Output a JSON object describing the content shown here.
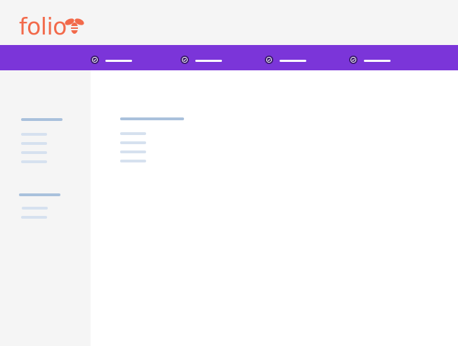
{
  "app": {
    "logo_text": "folio",
    "logo_icon": "bee-icon",
    "brand_color": "#f26a4b",
    "accent_color": "#7b35d9"
  },
  "topbar": {
    "items": [
      {
        "icon": "check-circle-icon",
        "label": ""
      },
      {
        "icon": "check-circle-icon",
        "label": ""
      },
      {
        "icon": "check-circle-icon",
        "label": ""
      },
      {
        "icon": "check-circle-icon",
        "label": ""
      }
    ]
  },
  "sidebar": {
    "sections": [
      {
        "heading": "",
        "items": [
          "",
          "",
          "",
          ""
        ]
      },
      {
        "heading": "",
        "items": [
          "",
          ""
        ]
      }
    ]
  },
  "main": {
    "heading": "",
    "lines": [
      "",
      "",
      "",
      ""
    ]
  }
}
